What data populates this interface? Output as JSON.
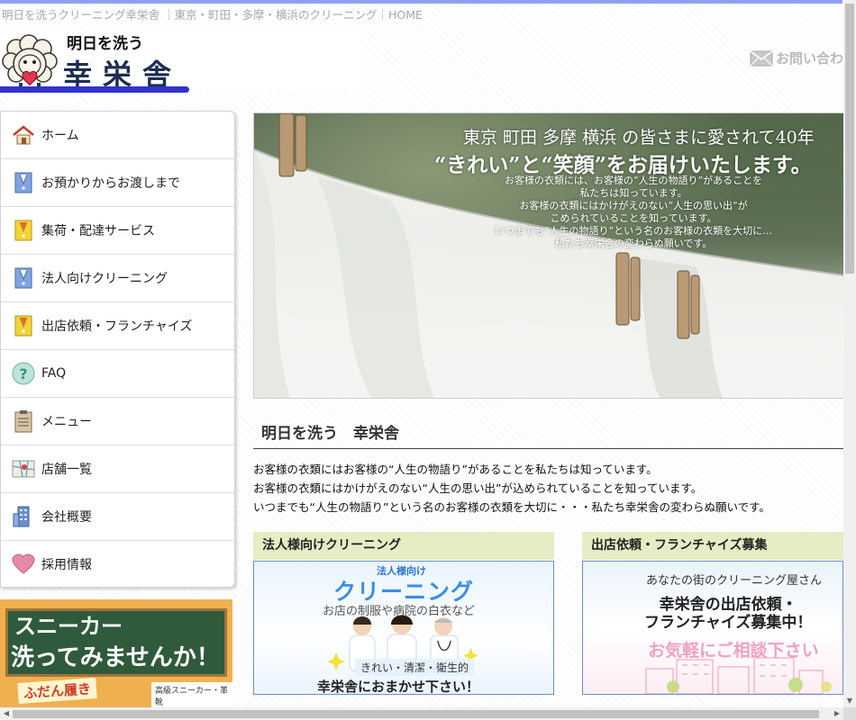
{
  "page": {
    "tagline": "明日を洗うクリーニング幸栄舎 ｜東京・町田・多摩・横浜のクリーニング｜HOME"
  },
  "header": {
    "logo_small": "明日を洗う",
    "logo_big": "幸栄舎",
    "contact_label": "お問い合わ"
  },
  "nav": {
    "items": [
      {
        "label": "ホーム",
        "icon": "house-icon"
      },
      {
        "label": "お預かりからお渡しまで",
        "icon": "shirt-tag-blue-icon"
      },
      {
        "label": "集荷・配達サービス",
        "icon": "shirt-tag-yellow-icon"
      },
      {
        "label": "法人向けクリーニング",
        "icon": "shirt-tag-blue-icon"
      },
      {
        "label": "出店依頼・フランチャイズ",
        "icon": "shirt-tag-yellow-icon"
      },
      {
        "label": "FAQ",
        "icon": "question-icon"
      },
      {
        "label": "メニュー",
        "icon": "clipboard-icon"
      },
      {
        "label": "店舗一覧",
        "icon": "map-icon"
      },
      {
        "label": "会社概要",
        "icon": "building-icon"
      },
      {
        "label": "採用情報",
        "icon": "heart-icon"
      }
    ]
  },
  "side_banner": {
    "line1": "スニーカー",
    "line2": "洗ってみませんか！",
    "line3": "ふだん履き",
    "line4": "高級スニーカー・革靴"
  },
  "hero": {
    "line1": "東京 町田 多摩 横浜 の皆さまに愛されて40年",
    "line2": "“きれい”と“笑顔”をお届けいたします。",
    "paragraph": "お客様の衣類には、お客様の“人生の物語り”があることを\n私たちは知っています。\nお客様の衣類にはかけがえのない“人生の思い出”が\nこめられていることを知っています。\nいつまでも“人生の物語り”という名のお客様の衣類を大切に…\n私たち幸栄舎の変わらぬ願いです。"
  },
  "main": {
    "section_title": "明日を洗う　幸栄舎",
    "intro": [
      "お客様の衣類にはお客様の“人生の物語り”があることを私たちは知っています。",
      "お客様の衣類にはかけがえのない“人生の思い出”が込められていることを知っています。",
      "いつまでも“人生の物語り”という名のお客様の衣類を大切に・・・私たち幸栄舎の変わらぬ願いです。"
    ]
  },
  "cards": [
    {
      "title": "法人様向けクリーニング",
      "t1": "法人様向け",
      "t2": "クリーニング",
      "t3": "お店の制服や病院の白衣など",
      "t4": "きれい・清潔・衛生的",
      "t5": "幸栄舎におまかせ下さい！"
    },
    {
      "title": "出店依頼・フランチャイズ募集",
      "t1": "あなたの街のクリーニング屋さん",
      "t2": "幸栄舎の出店依頼・\nフランチャイズ募集中！",
      "t3": "お気軽にご相談下さい"
    }
  ],
  "colors": {
    "accent_blue": "#3333cc",
    "card_header": "#e4edc4",
    "topbar": "#8f9fef"
  }
}
